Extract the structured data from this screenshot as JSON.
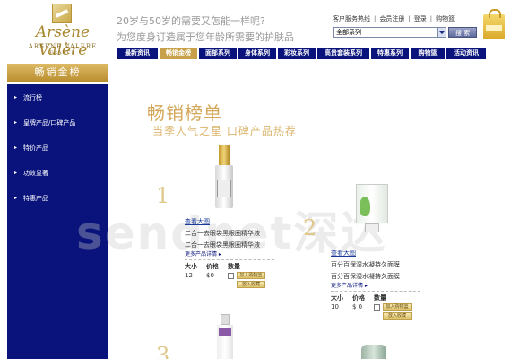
{
  "header": {
    "brand_signature": "Arsène Valère",
    "brand_name": "ARSENE VALERE",
    "brand_country": "FRANCE",
    "slogan_line1": "20岁与50岁的需要又怎能一样呢?",
    "slogan_line2": "为您度身订造属于您年龄所需要的护肤品",
    "top_links": [
      "客户服务热线",
      "会员注册",
      "登录",
      "购物篮"
    ],
    "series_select": "全部系列",
    "search_button": "搜 索",
    "cart_icon": "shopping-bag-icon"
  },
  "nav": {
    "tabs": [
      {
        "label": "最新资讯",
        "active": false
      },
      {
        "label": "畅销金榜",
        "active": true
      },
      {
        "label": "面部系列",
        "active": false
      },
      {
        "label": "身体系列",
        "active": false
      },
      {
        "label": "彩妆系列",
        "active": false
      },
      {
        "label": "高贵套装系列",
        "active": false
      },
      {
        "label": "特惠系列",
        "active": false
      },
      {
        "label": "购物篮",
        "active": false
      },
      {
        "label": "活动资讯",
        "active": false
      }
    ]
  },
  "sidebar": {
    "heading": "畅销金榜",
    "items": [
      {
        "label": "流行榜"
      },
      {
        "label": "皇牌产品/口碑产品"
      },
      {
        "label": "特价产品"
      },
      {
        "label": "功效显著"
      },
      {
        "label": "特惠产品"
      }
    ]
  },
  "main": {
    "title": "畅销榜单",
    "subtitle": "当季人气之星 口碑产品热荐",
    "watermark": "sendnet深达",
    "products": [
      {
        "rank": "1",
        "view_large": "查看大图",
        "name": "二合一去眼袋黑眼圈精华液",
        "name2": "二合一去眼袋黑眼圈精华液",
        "more": "更多产品详情",
        "col_size": "大小",
        "col_price": "价格",
        "col_qty": "数量",
        "size": "12",
        "price": "$0",
        "add_to_cart": "加入购物篮",
        "favorite": "放入收藏"
      },
      {
        "rank": "2",
        "view_large": "查看大图",
        "name": "百分百保湿水凝持久面膜",
        "name2": "百分百保湿水凝持久面膜",
        "more": "更多产品详情",
        "col_size": "大小",
        "col_price": "价格",
        "col_qty": "数量",
        "size": "10",
        "price": "$ 0",
        "add_to_cart": "加入购物篮",
        "favorite": "放入收藏"
      },
      {
        "rank": "3"
      }
    ]
  },
  "colors": {
    "nav_blue": "#0a137c",
    "gold": "#c8a04a",
    "title_gold": "#d4a85a"
  }
}
